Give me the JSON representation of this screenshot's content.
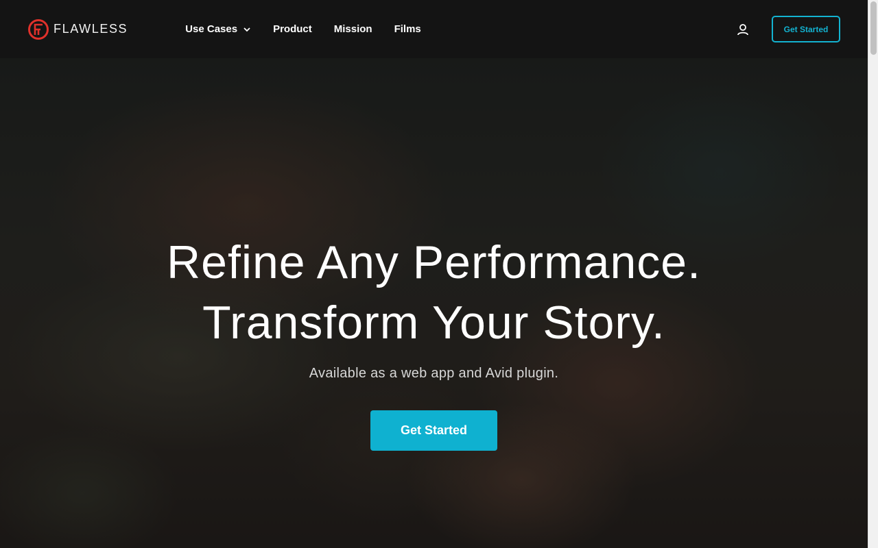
{
  "brand": {
    "name": "FLAWLESS",
    "logo_color": "#e0312b"
  },
  "nav": {
    "items": [
      {
        "label": "Use Cases",
        "has_dropdown": true
      },
      {
        "label": "Product"
      },
      {
        "label": "Mission"
      },
      {
        "label": "Films"
      }
    ]
  },
  "header": {
    "account_icon": "user-icon",
    "cta_label": "Get Started"
  },
  "hero": {
    "headline_line1": "Refine Any Performance.",
    "headline_line2": "Transform Your Story.",
    "subheadline": "Available as a web app and Avid plugin.",
    "cta_label": "Get Started"
  },
  "colors": {
    "accent": "#13b3d1",
    "header_bg": "#141414",
    "text": "#ffffff"
  }
}
